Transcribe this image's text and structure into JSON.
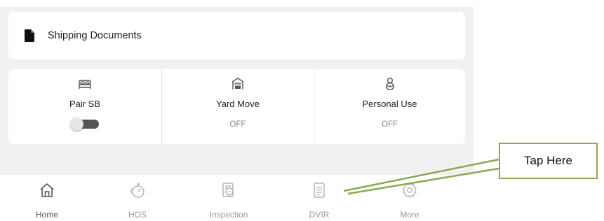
{
  "shipping": {
    "title": "Shipping Documents",
    "icon": "document-icon"
  },
  "modes": [
    {
      "label": "Pair SB",
      "icon": "bed-icon",
      "control": "toggle",
      "toggle_on": false
    },
    {
      "label": "Yard Move",
      "icon": "garage-icon",
      "state": "OFF"
    },
    {
      "label": "Personal Use",
      "icon": "driver-icon",
      "state": "OFF"
    }
  ],
  "nav": [
    {
      "label": "Home",
      "icon": "home-icon",
      "active": true
    },
    {
      "label": "HOS",
      "icon": "stopwatch-icon",
      "active": false
    },
    {
      "label": "Inspection",
      "icon": "inspection-icon",
      "active": false
    },
    {
      "label": "DVIR",
      "icon": "report-icon",
      "active": false
    },
    {
      "label": "More",
      "icon": "gear-icon",
      "active": false
    }
  ],
  "callout": {
    "text": "Tap Here"
  },
  "colors": {
    "callout_border": "#8aa954",
    "active_icon": "#555555",
    "inactive_icon": "#b3b3b3"
  }
}
